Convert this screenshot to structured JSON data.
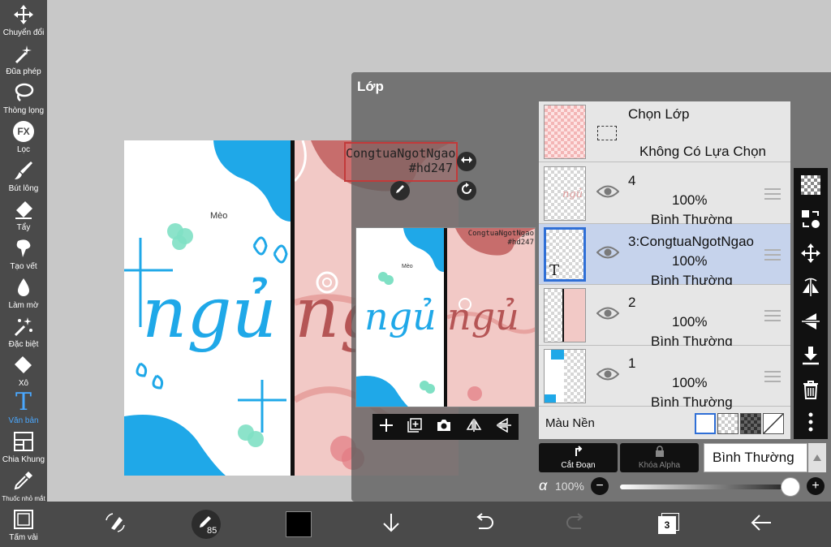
{
  "toolbar_left": {
    "items": [
      {
        "label": "Chuyển đổi",
        "icon": "move-arrows-icon"
      },
      {
        "label": "Đũa phép",
        "icon": "magic-wand-icon"
      },
      {
        "label": "Thòng lọng",
        "icon": "lasso-icon"
      },
      {
        "label": "Lọc",
        "icon": "fx-filter-icon",
        "icon_text": "FX"
      },
      {
        "label": "Bút lông",
        "icon": "brush-icon"
      },
      {
        "label": "Tẩy",
        "icon": "eraser-icon"
      },
      {
        "label": "Tạo vết",
        "icon": "smudge-icon"
      },
      {
        "label": "Làm mờ",
        "icon": "blur-drop-icon"
      },
      {
        "label": "Đặc biệt",
        "icon": "special-sparkle-icon"
      },
      {
        "label": "Xô",
        "icon": "bucket-icon"
      },
      {
        "label": "Văn bản",
        "icon": "text-tool-icon",
        "icon_text": "T",
        "active": true
      },
      {
        "label": "Chia Khung",
        "icon": "frame-divider-icon"
      },
      {
        "label": "Thuốc nhỏ mắt",
        "icon": "eyedropper-icon"
      },
      {
        "label": "Tấm vải",
        "icon": "canvas-icon"
      }
    ],
    "active_color": "#4aa8ff"
  },
  "canvas": {
    "art_left_label": "Mèo",
    "art_left_word": "ngủ",
    "art_right_word": "ngủ",
    "text_selection": "CongtuaNgotNgao\n#hd247",
    "preview_text": "CongtuaNgotNgao\n#hd247",
    "preview_label": "Mèo"
  },
  "layer_panel": {
    "title": "Lớp",
    "select_layer": {
      "name": "Chọn Lớp",
      "status": "Không Có Lựa Chọn"
    },
    "layers": [
      {
        "name": "4",
        "opacity": "100%",
        "blend": "Bình Thường",
        "thumb_text": "ngủ",
        "selected": false
      },
      {
        "name": "3:CongtuaNgotNgao",
        "opacity": "100%",
        "blend": "Bình Thường",
        "thumb_text": "T",
        "selected": true
      },
      {
        "name": "2",
        "opacity": "100%",
        "blend": "Bình Thường",
        "selected": false
      },
      {
        "name": "1",
        "opacity": "100%",
        "blend": "Bình Thường",
        "selected": false
      }
    ],
    "background": {
      "label": "Màu Nền"
    },
    "clip_label": "Cắt Đoạn",
    "alpha_lock_label": "Khóa Alpha",
    "alpha_lock_symbol": "α",
    "blend_mode": "Bình Thường",
    "opacity": {
      "symbol": "α",
      "value_label": "100%",
      "value": 1.0,
      "minus": "−",
      "plus": "+"
    }
  },
  "toolbar_bottom": {
    "brush_size": "85",
    "layer_count": "3",
    "color": "#000000"
  },
  "colors": {
    "toolbar_bg": "#4a4a4a",
    "selected_layer": "#c6d3ec",
    "accent_blue": "#1fa8e8",
    "pink": "#f2c9c6"
  }
}
